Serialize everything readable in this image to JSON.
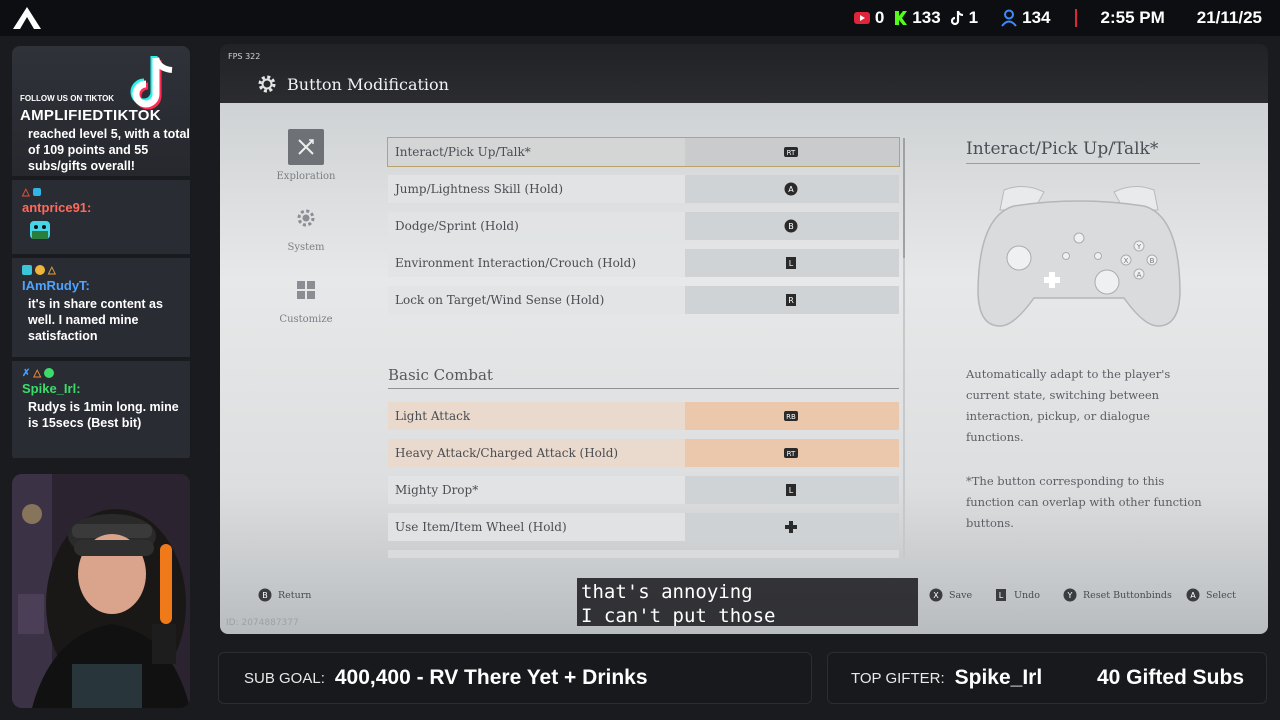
{
  "topbar": {
    "youtube_count": "0",
    "kick_count": "133",
    "tiktok_count": "1",
    "viewers": "134",
    "time": "2:55 PM",
    "date": "21/11/25"
  },
  "tiktok_banner": {
    "follow_text": "FOLLOW US ON TIKTOK",
    "handle": "AMPLIFIEDTIKTOK",
    "note": "reached level 5, with a total of 109 points and 55 subs/gifts overall!"
  },
  "chat": [
    {
      "user": "antprice91:",
      "user_color": "#ff6a5c",
      "text": "",
      "badges": [
        "#e5533d",
        "#2fb5e6"
      ]
    },
    {
      "user": "IAmRudyT:",
      "user_color": "#4ea3ff",
      "text": "it's in share content as well. I named mine satisfaction",
      "badges": [
        "#3cc4d8",
        "#f0b43a",
        "#e0a240"
      ]
    },
    {
      "user": "Spike_Irl:",
      "user_color": "#3ddc6a",
      "text": "Rudys is 1min long. mine is 15secs (Best bit)",
      "badges": [
        "#3aa0ff",
        "#f08a3a",
        "#3ddc6a"
      ]
    }
  ],
  "game": {
    "fps_label": "FPS",
    "fps_value": "322",
    "title": "Button Modification",
    "categories": [
      {
        "label": "Exploration",
        "icon": "crossed-swords-icon",
        "active": true
      },
      {
        "label": "System",
        "icon": "gear-icon",
        "active": false
      },
      {
        "label": "Customize",
        "icon": "grid-icon",
        "active": false
      }
    ],
    "exploration_rows": [
      {
        "label": "Interact/Pick Up/Talk*",
        "button": "RT"
      },
      {
        "label": "Jump/Lightness Skill (Hold)",
        "button": "A"
      },
      {
        "label": "Dodge/Sprint (Hold)",
        "button": "B"
      },
      {
        "label": "Environment Interaction/Crouch (Hold)",
        "button": "LT"
      },
      {
        "label": "Lock on Target/Wind Sense (Hold)",
        "button": "RS"
      }
    ],
    "section_title": "Basic Combat",
    "combat_rows": [
      {
        "label": "Light Attack",
        "button": "RB"
      },
      {
        "label": "Heavy Attack/Charged Attack (Hold)",
        "button": "RT"
      },
      {
        "label": "Mighty Drop*",
        "button": "LT"
      },
      {
        "label": "Use Item/Item Wheel (Hold)",
        "button": "DPAD"
      }
    ],
    "detail_title": "Interact/Pick Up/Talk*",
    "description": "Automatically adapt to the player's current state, switching between interaction, pickup, or dialogue functions.",
    "note": "*The button corresponding to this function can overlap with other function buttons.",
    "hints": {
      "return": "Return",
      "save": "Save",
      "undo": "Undo",
      "reset": "Reset Buttonbinds",
      "select": "Select"
    },
    "id_text": "ID: 2074887377"
  },
  "caption": {
    "line1": "that's annoying",
    "line2": "I can't put those"
  },
  "sub_goal": {
    "label": "SUB GOAL:",
    "value": "400,400 - RV There Yet + Drinks"
  },
  "top_gifter": {
    "label": "TOP GIFTER:",
    "name": "Spike_Irl",
    "amount": "40 Gifted Subs"
  },
  "colors": {
    "accent_red": "#e0243a",
    "kick_green": "#53fc18",
    "viewer_blue": "#3d8bff"
  }
}
